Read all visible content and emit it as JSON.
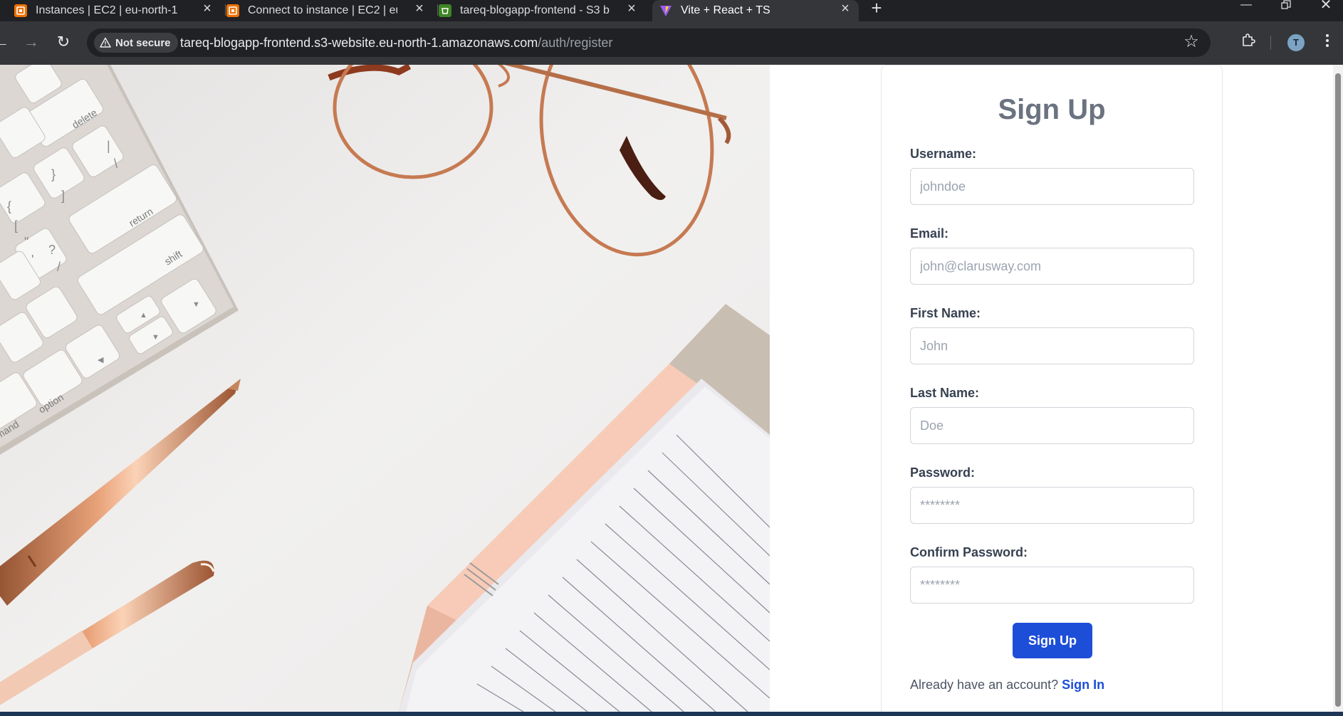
{
  "browser": {
    "tabs": [
      {
        "title": "Instances | EC2 | eu-north-1",
        "icon": "aws-ec2-icon",
        "icon_color": "#ed7100"
      },
      {
        "title": "Connect to instance | EC2 | eu-n",
        "icon": "aws-ec2-icon",
        "icon_color": "#ed7100"
      },
      {
        "title": "tareq-blogapp-frontend - S3 bu",
        "icon": "aws-s3-icon",
        "icon_color": "#3f8624"
      },
      {
        "title": "Vite + React + TS",
        "icon": "vite-icon",
        "icon_color": "#9a5cf5"
      }
    ],
    "security_label": "Not secure",
    "url_host": "tareq-blogapp-frontend.s3-website.eu-north-1.amazonaws.com",
    "url_path": "/auth/register",
    "profile_initial": "T"
  },
  "hero": {
    "keyboard_keys": [
      "delete",
      "return",
      "shift",
      "option",
      "mand"
    ]
  },
  "form": {
    "title": "Sign Up",
    "fields": [
      {
        "label": "Username:",
        "placeholder": "johndoe",
        "type": "text"
      },
      {
        "label": "Email:",
        "placeholder": "john@clarusway.com",
        "type": "email"
      },
      {
        "label": "First Name:",
        "placeholder": "John",
        "type": "text"
      },
      {
        "label": "Last Name:",
        "placeholder": "Doe",
        "type": "text"
      },
      {
        "label": "Password:",
        "placeholder": "********",
        "type": "password"
      },
      {
        "label": "Confirm Password:",
        "placeholder": "********",
        "type": "password"
      }
    ],
    "submit_label": "Sign Up",
    "footer_text": "Already have an account?",
    "footer_link": "Sign In"
  },
  "colors": {
    "primary": "#1d4ed8",
    "heading": "#6b7280"
  }
}
